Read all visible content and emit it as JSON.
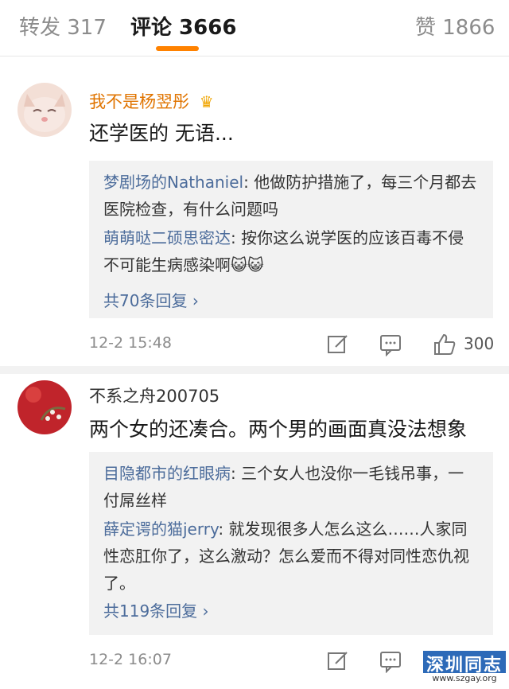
{
  "tabs": [
    {
      "label": "转发 317"
    },
    {
      "label": "评论 3666"
    },
    {
      "label": "赞 1866"
    }
  ],
  "comments": [
    {
      "user": "我不是杨翌彤",
      "user_color": "#e07400",
      "badge_icon": "crown-icon",
      "text": "还学医的 无语...",
      "replies": [
        {
          "name": "梦剧场的Nathaniel",
          "sep": ": ",
          "text": "他做防护措施了，每三个月都去医院检查，有什么问题吗"
        },
        {
          "name": "萌萌哒二硕思密达",
          "sep": ": ",
          "text": "按你这么说学医的应该百毒不侵不可能生病感染啊",
          "emoji": "😺😺"
        }
      ],
      "more": "共70条回复",
      "time": "12-2 15:48",
      "likes": "300"
    },
    {
      "user": "不系之舟200705",
      "user_color": "#333333",
      "text": "两个女的还凑合。两个男的画面真没法想象",
      "replies": [
        {
          "name": "目隐都市的红眼病",
          "sep": ": ",
          "text": "三个女人也没你一毛钱吊事，一付屌丝样"
        },
        {
          "name": "薛定谔的猫jerry",
          "sep": ": ",
          "text": "就发现很多人怎么这么……人家同性恋肛你了，这么激动？怎么爱而不得对同性恋仇视了。"
        }
      ],
      "more": "共119条回复",
      "time": "12-2 16:07",
      "likes": ""
    }
  ],
  "watermark": {
    "title": "深圳同志",
    "url": "www.szgay.org"
  },
  "colors": {
    "accent": "#ff8200",
    "link": "#4c6c9b"
  }
}
